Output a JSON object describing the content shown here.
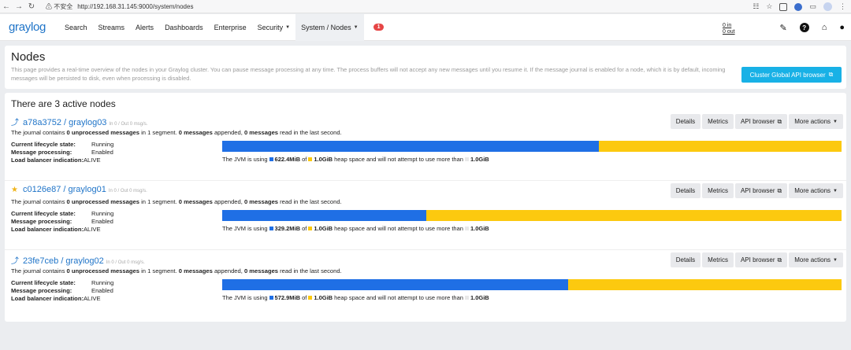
{
  "browser": {
    "security_label": "不安全",
    "url": "http://192.168.31.145:9000/system/nodes"
  },
  "navbar": {
    "brand": "graylog",
    "items": [
      {
        "label": "Search"
      },
      {
        "label": "Streams"
      },
      {
        "label": "Alerts"
      },
      {
        "label": "Dashboards"
      },
      {
        "label": "Enterprise"
      },
      {
        "label": "Security"
      },
      {
        "label": "System / Nodes"
      }
    ],
    "notification_count": "1",
    "throughput_in": "0 in",
    "throughput_out": "0 out"
  },
  "header": {
    "title": "Nodes",
    "description": "This page provides a real-time overview of the nodes in your Graylog cluster. You can pause message processing at any time. The process buffers will not accept any new messages until you resume it. If the message journal is enabled for a node, which it is by default, incoming messages will be persisted to disk, even when processing is disabled.",
    "global_api_button": "Cluster Global API browser"
  },
  "nodes_section": {
    "title": "There are 3 active nodes"
  },
  "labels": {
    "details": "Details",
    "metrics": "Metrics",
    "api_browser": "API browser",
    "more_actions": "More actions",
    "lifecycle": "Current lifecycle state:",
    "processing": "Message processing:",
    "lb": "Load balancer indication:",
    "journal_pre": "The journal contains ",
    "journal_unprocessed": "0 unprocessed messages",
    "journal_mid": " in 1 segment. ",
    "journal_appended": "0 messages",
    "journal_mid2": " appended, ",
    "journal_read": "0 messages",
    "journal_post": " read in the last second.",
    "jvm_pre": "The JVM is using ",
    "jvm_of": " of ",
    "jvm_mid": " heap space and will not attempt to use more than ",
    "max_heap": "1.0GiB"
  },
  "colors": {
    "used": "#1f6fe5",
    "committed": "#fcc90f",
    "max": "#e8e8e8",
    "accent": "#1f74c8"
  },
  "nodes": [
    {
      "id_name": "a78a3752 / graylog03",
      "icon": "leader-arrow-icon",
      "rate": "In 0 / Out 0 msg/s.",
      "lifecycle": "Running",
      "processing": "Enabled",
      "lb": "ALIVE",
      "used": "622.4MiB",
      "committed": "1.0GiB",
      "used_fraction": 0.608
    },
    {
      "id_name": "c0126e87 / graylog01",
      "icon": "star-icon",
      "rate": "In 0 / Out 0 msg/s.",
      "lifecycle": "Running",
      "processing": "Enabled",
      "lb": "ALIVE",
      "used": "329.2MiB",
      "committed": "1.0GiB",
      "used_fraction": 0.329
    },
    {
      "id_name": "23fe7ceb / graylog02",
      "icon": "leader-arrow-icon",
      "rate": "In 0 / Out 0 msg/s.",
      "lifecycle": "Running",
      "processing": "Enabled",
      "lb": "ALIVE",
      "used": "572.9MiB",
      "committed": "1.0GiB",
      "used_fraction": 0.559
    }
  ]
}
